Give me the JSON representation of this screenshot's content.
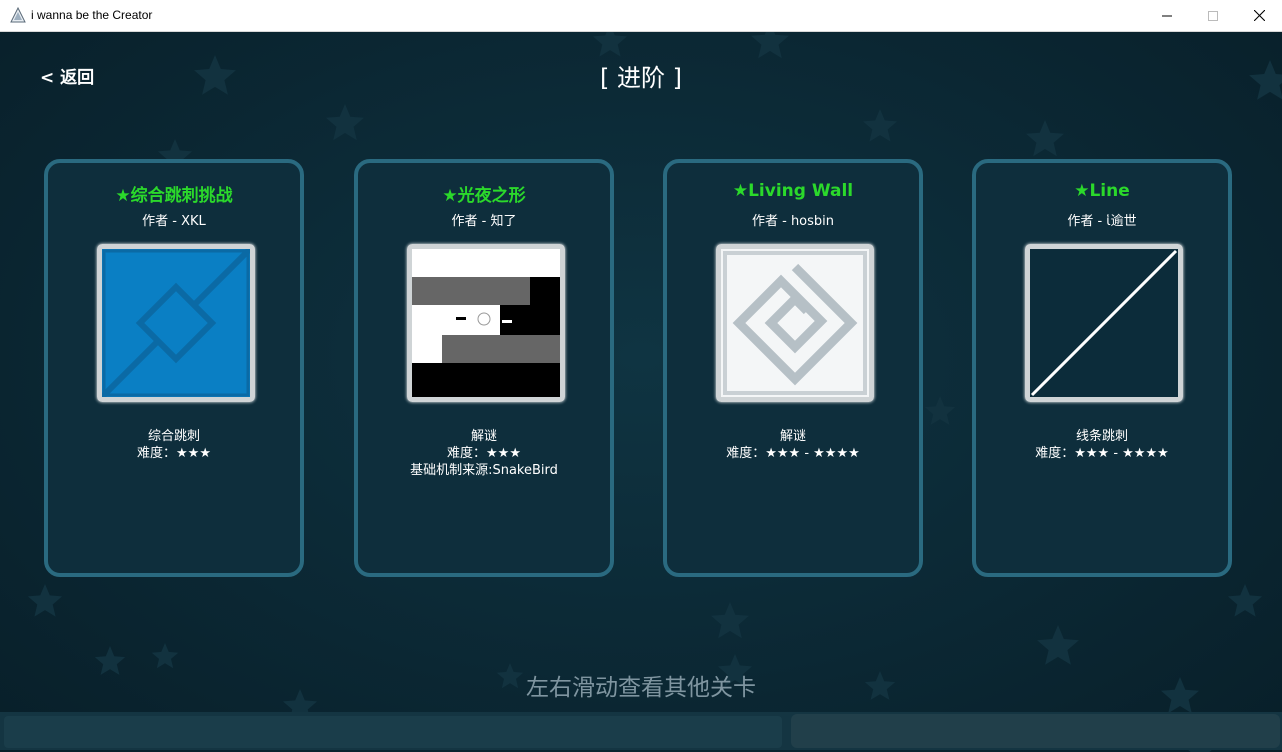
{
  "window": {
    "title": "i wanna be the Creator",
    "icon": "triangle-app-icon"
  },
  "header": {
    "back_label": "< 返回",
    "title": "[ 进阶 ]"
  },
  "levels": [
    {
      "title": "★综合跳刺挑战",
      "author": "作者 - XKL",
      "thumbnail": "blue-diamond-thumbnail",
      "category": "综合跳刺",
      "difficulty": "难度：★★★",
      "extra": ""
    },
    {
      "title": "★光夜之形",
      "author": "作者 - 知了",
      "thumbnail": "black-white-maze-thumbnail",
      "category": "解谜",
      "difficulty": "难度：★★★",
      "extra": "基础机制来源:SnakeBird"
    },
    {
      "title": "★Living Wall",
      "author": "作者 - hosbin",
      "thumbnail": "spiral-thumbnail",
      "category": "解谜",
      "difficulty": "难度：★★★ - ★★★★",
      "extra": ""
    },
    {
      "title": "★Line",
      "author": "作者 - ἱ逾世",
      "thumbnail": "diagonal-line-thumbnail",
      "category": "线条跳刺",
      "difficulty": "难度：★★★ - ★★★★",
      "extra": ""
    }
  ],
  "footer": {
    "hint": "左右滑动查看其他关卡"
  },
  "colors": {
    "title_green": "#2bd92b",
    "card_border": "#2a6a80",
    "background": "#0b2a38"
  }
}
